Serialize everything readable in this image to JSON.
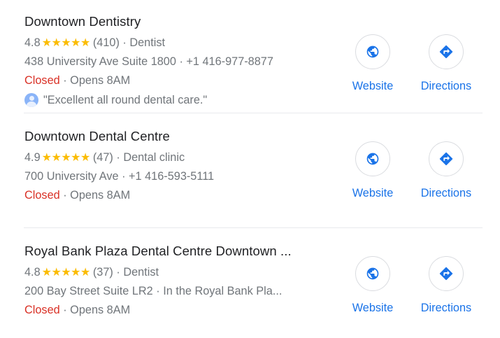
{
  "results": [
    {
      "name": "Downtown Dentistry",
      "rating": "4.8",
      "stars": "★★★★★",
      "reviews": "(410)",
      "category": "Dentist",
      "address": "438 University Ave Suite 1800",
      "phone": "+1 416-977-8877",
      "status": "Closed",
      "hours": "Opens 8AM",
      "review_snippet": "\"Excellent all round dental care.\"",
      "website_label": "Website",
      "directions_label": "Directions"
    },
    {
      "name": "Downtown Dental Centre",
      "rating": "4.9",
      "stars": "★★★★★",
      "reviews": "(47)",
      "category": "Dental clinic",
      "address": "700 University Ave",
      "phone": "+1 416-593-5111",
      "status": "Closed",
      "hours": "Opens 8AM",
      "website_label": "Website",
      "directions_label": "Directions"
    },
    {
      "name": "Royal Bank Plaza Dental Centre Downtown ...",
      "rating": "4.8",
      "stars": "★★★★★",
      "reviews": "(37)",
      "category": "Dentist",
      "address": "200 Bay Street Suite LR2",
      "location_note": "In the Royal Bank Pla...",
      "status": "Closed",
      "hours": "Opens 8AM",
      "website_label": "Website",
      "directions_label": "Directions"
    }
  ],
  "separator": "·",
  "icons": {
    "website": "globe-icon",
    "directions": "directions-icon",
    "reviewer": "avatar-icon"
  },
  "colors": {
    "link": "#1a73e8",
    "closed": "#d93025",
    "star": "#fbbc04",
    "secondary": "#70757a"
  }
}
